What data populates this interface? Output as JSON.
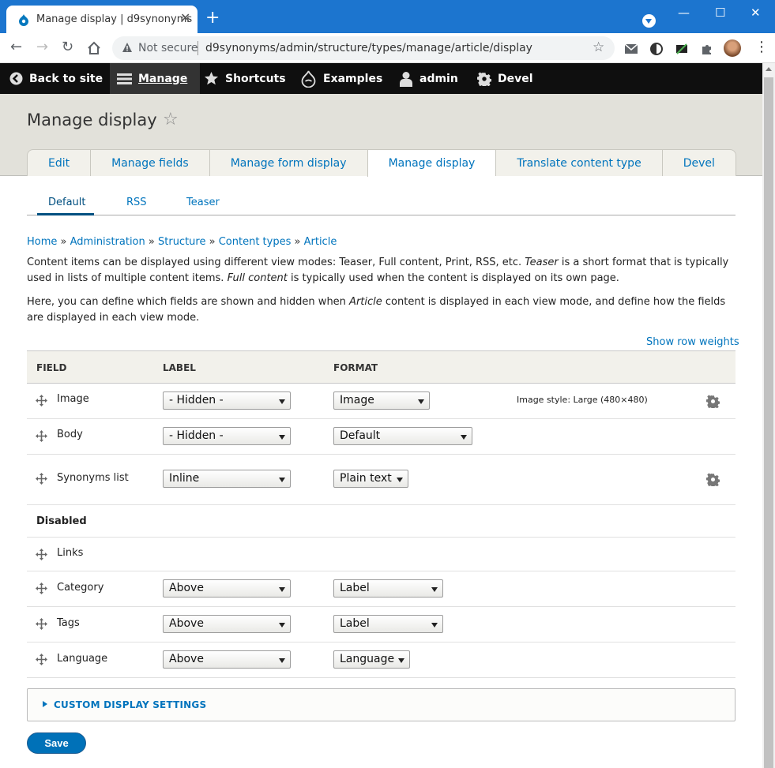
{
  "browser": {
    "tab_title": "Manage display | d9synonyms",
    "tab_close": "✕",
    "new_tab": "+",
    "not_secure": "Not secure",
    "url": "d9synonyms/admin/structure/types/manage/article/display",
    "window_controls": {
      "minimize": "—",
      "maximize": "☐",
      "close": "✕"
    }
  },
  "admin_toolbar": {
    "back_to_site": "Back to site",
    "manage": "Manage",
    "shortcuts": "Shortcuts",
    "examples": "Examples",
    "admin": "admin",
    "devel": "Devel"
  },
  "page": {
    "title": "Manage display",
    "favorite_star": "☆"
  },
  "primary_tabs": [
    {
      "label": "Edit"
    },
    {
      "label": "Manage fields"
    },
    {
      "label": "Manage form display"
    },
    {
      "label": "Manage display",
      "active": true
    },
    {
      "label": "Translate content type"
    },
    {
      "label": "Devel"
    }
  ],
  "secondary_tabs": [
    {
      "label": "Default",
      "active": true
    },
    {
      "label": "RSS"
    },
    {
      "label": "Teaser"
    }
  ],
  "breadcrumb": {
    "items": [
      "Home",
      "Administration",
      "Structure",
      "Content types",
      "Article"
    ],
    "separator": "»"
  },
  "help": {
    "p1": {
      "a": "Content items can be displayed using different view modes: Teaser, Full content, Print, RSS, etc. ",
      "em1": "Teaser",
      "b": " is a short format that is typically used in lists of multiple content items. ",
      "em2": "Full content",
      "c": " is typically used when the content is displayed on its own page."
    },
    "p2": {
      "a": "Here, you can define which fields are shown and hidden when ",
      "em": "Article",
      "b": " content is displayed in each view mode, and define how the fields are displayed in each view mode."
    }
  },
  "show_row_weights": "Show row weights",
  "table": {
    "headers": {
      "field": "FIELD",
      "label": "LABEL",
      "format": "FORMAT"
    },
    "rows": [
      {
        "field": "Image",
        "label": "- Hidden -",
        "format": "Image",
        "summary": "Image style: Large (480×480)"
      },
      {
        "field": "Body",
        "label": "- Hidden -",
        "format": "Default"
      },
      {
        "field": "Synonyms list",
        "label": "Inline",
        "format": "Plain text"
      }
    ],
    "disabled_label": "Disabled",
    "disabled_rows": [
      {
        "field": "Links"
      },
      {
        "field": "Category",
        "label": "Above",
        "format": "Label"
      },
      {
        "field": "Tags",
        "label": "Above",
        "format": "Label"
      },
      {
        "field": "Language",
        "label": "Above",
        "format": "Language"
      }
    ]
  },
  "custom_display_settings": "CUSTOM DISPLAY SETTINGS",
  "save_button": "Save",
  "colors": {
    "link": "#0074bd",
    "browser_titlebar": "#1c75cf",
    "admin_toolbar": "#0f0f0f",
    "header_bg": "#e2e1da",
    "save_button": "#0071b8"
  }
}
